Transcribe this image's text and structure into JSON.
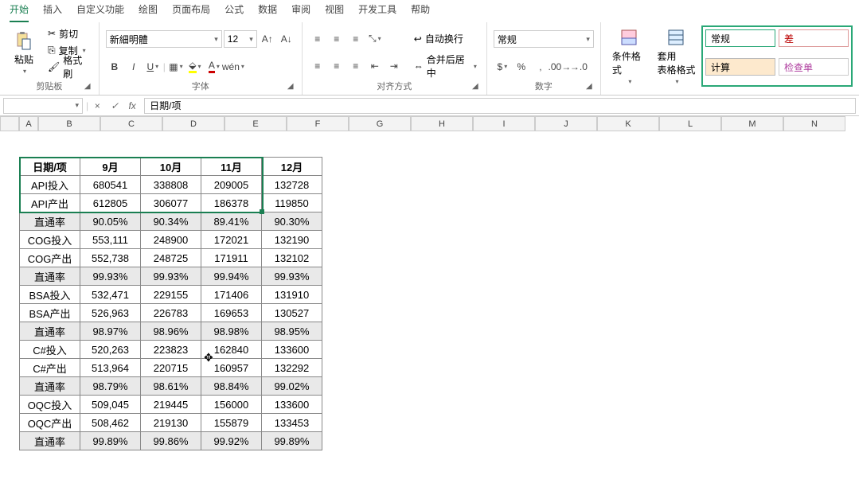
{
  "tabs": [
    "开始",
    "插入",
    "自定义功能",
    "绘图",
    "页面布局",
    "公式",
    "数据",
    "审阅",
    "视图",
    "开发工具",
    "帮助"
  ],
  "active_tab": 0,
  "clipboard": {
    "paste": "粘贴",
    "cut": "剪切",
    "copy": "复制",
    "painter": "格式刷",
    "group": "剪贴板"
  },
  "font": {
    "name": "新細明體",
    "size": "12",
    "group": "字体"
  },
  "align": {
    "wrap": "自动换行",
    "merge": "合并后居中",
    "group": "对齐方式"
  },
  "number": {
    "format": "常规",
    "group": "数字"
  },
  "styles": {
    "cond": "条件格式",
    "table": "套用\n表格格式",
    "s1": "常规",
    "s2": "差",
    "s3": "计算",
    "s4": "检查单"
  },
  "formula_bar": {
    "name": "",
    "formula": "日期/项"
  },
  "colheaders": [
    "A",
    "B",
    "C",
    "D",
    "E",
    "F",
    "G",
    "H",
    "I",
    "J",
    "K",
    "L",
    "M",
    "N"
  ],
  "rowcount": 30,
  "chart_data": {
    "type": "table",
    "title": "日期/项",
    "columns": [
      "日期/项",
      "9月",
      "10月",
      "11月",
      "12月"
    ],
    "rows": [
      {
        "label": "API投入",
        "values": [
          "680541",
          "338808",
          "209005",
          "132728"
        ],
        "shade": false
      },
      {
        "label": "API产出",
        "values": [
          "612805",
          "306077",
          "186378",
          "119850"
        ],
        "shade": false
      },
      {
        "label": "直通率",
        "values": [
          "90.05%",
          "90.34%",
          "89.41%",
          "90.30%"
        ],
        "shade": true
      },
      {
        "label": "COG投入",
        "values": [
          "553,111",
          "248900",
          "172021",
          "132190"
        ],
        "shade": false
      },
      {
        "label": "COG产出",
        "values": [
          "552,738",
          "248725",
          "171911",
          "132102"
        ],
        "shade": false
      },
      {
        "label": "直通率",
        "values": [
          "99.93%",
          "99.93%",
          "99.94%",
          "99.93%"
        ],
        "shade": true
      },
      {
        "label": "BSA投入",
        "values": [
          "532,471",
          "229155",
          "171406",
          "131910"
        ],
        "shade": false
      },
      {
        "label": "BSA产出",
        "values": [
          "526,963",
          "226783",
          "169653",
          "130527"
        ],
        "shade": false
      },
      {
        "label": "直通率",
        "values": [
          "98.97%",
          "98.96%",
          "98.98%",
          "98.95%"
        ],
        "shade": true
      },
      {
        "label": "C#投入",
        "values": [
          "520,263",
          "223823",
          "162840",
          "133600"
        ],
        "shade": false
      },
      {
        "label": "C#产出",
        "values": [
          "513,964",
          "220715",
          "160957",
          "132292"
        ],
        "shade": false
      },
      {
        "label": "直通率",
        "values": [
          "98.79%",
          "98.61%",
          "98.84%",
          "99.02%"
        ],
        "shade": true
      },
      {
        "label": "OQC投入",
        "values": [
          "509,045",
          "219445",
          "156000",
          "133600"
        ],
        "shade": false
      },
      {
        "label": "OQC产出",
        "values": [
          "508,462",
          "219130",
          "155879",
          "133453"
        ],
        "shade": false
      },
      {
        "label": "直通率",
        "values": [
          "99.89%",
          "99.86%",
          "99.92%",
          "99.89%"
        ],
        "shade": true
      }
    ]
  }
}
